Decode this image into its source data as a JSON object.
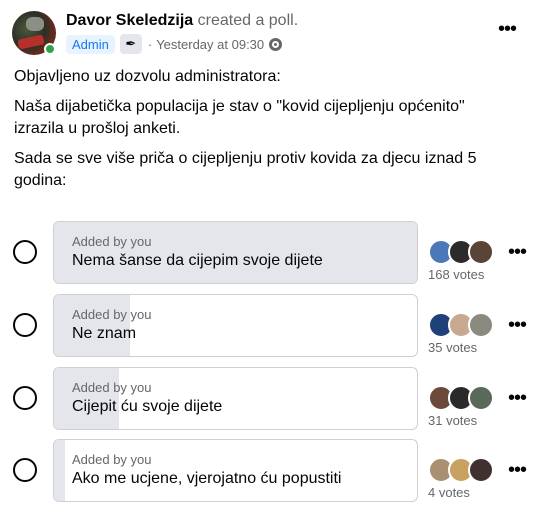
{
  "post": {
    "author": "Davor Skeledzija",
    "action": "created a poll.",
    "badge": "Admin",
    "badge_icon": "feather-pen-icon",
    "timestamp": "Yesterday at 09:30",
    "separator": "·",
    "audience_icon": "group-globe-icon",
    "paragraphs": [
      "Objavljeno uz dozvolu administratora:",
      "Naša dijabetička populacija je stav o \"kovid cijepljenju općenito\" izrazila u prošloj anketi.",
      "Sada se sve više priča o cijepljenju protiv kovida za djecu iznad 5 godina:"
    ]
  },
  "poll": {
    "options": [
      {
        "added_by": "Added by you",
        "label": "Nema šanse da cijepim svoje dijete",
        "votes_text": "168 votes",
        "votes": 168,
        "fill_fraction": 1.0,
        "voter_colors": [
          "#4a78b8",
          "#2b2b2b",
          "#5a4438"
        ]
      },
      {
        "added_by": "Added by you",
        "label": "Ne znam",
        "votes_text": "35 votes",
        "votes": 35,
        "fill_fraction": 0.21,
        "voter_colors": [
          "#20407a",
          "#c8a890",
          "#8a8a80"
        ]
      },
      {
        "added_by": "Added by you",
        "label": "Cijepit ću svoje dijete",
        "votes_text": "31 votes",
        "votes": 31,
        "fill_fraction": 0.18,
        "voter_colors": [
          "#6b4a3a",
          "#2a2a2a",
          "#5a6a5a"
        ]
      },
      {
        "added_by": "Added by you",
        "label": "Ako me ucjene, vjerojatno ću popustiti",
        "votes_text": "4 votes",
        "votes": 4,
        "fill_fraction": 0.03,
        "voter_colors": [
          "#a89070",
          "#c8a060",
          "#403030"
        ]
      }
    ]
  },
  "icons": {
    "more": "•••",
    "pen": "✒"
  }
}
